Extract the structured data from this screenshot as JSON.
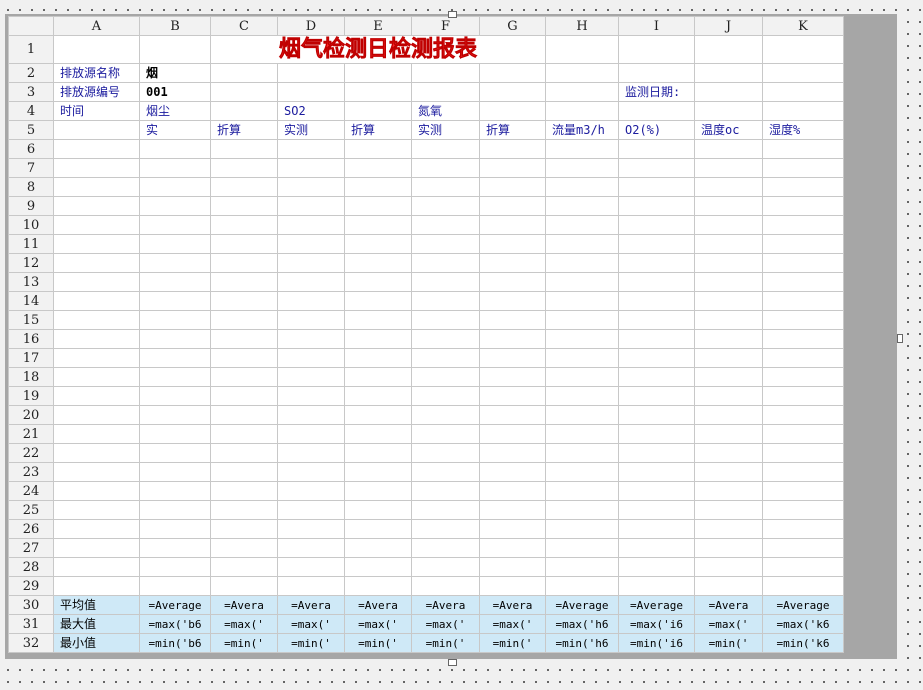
{
  "columns": [
    "A",
    "B",
    "C",
    "D",
    "E",
    "F",
    "G",
    "H",
    "I",
    "J",
    "K"
  ],
  "title": "烟气检测日检测报表",
  "row2": {
    "a": "排放源名称",
    "b": "烟"
  },
  "row3": {
    "a": "排放源编号",
    "b": "001",
    "i": "监测日期:"
  },
  "row4": {
    "a": "时间",
    "b": "烟尘",
    "d": "SO2",
    "f": "氮氧"
  },
  "row5": [
    "",
    "实",
    "折算",
    "实测",
    "折算",
    "实测",
    "折算",
    "流量m3/h",
    "O2(%)",
    "温度oc",
    "湿度%"
  ],
  "empty_rows": [
    6,
    7,
    8,
    9,
    10,
    11,
    12,
    13,
    14,
    15,
    16,
    17,
    18,
    19,
    20,
    21,
    22,
    23,
    24,
    25,
    26,
    27,
    28,
    29
  ],
  "stats": [
    {
      "row": "30",
      "label": "平均值",
      "cells": [
        "=Average",
        "=Avera",
        "=Avera",
        "=Avera",
        "=Avera",
        "=Avera",
        "=Average",
        "=Average",
        "=Avera",
        "=Average"
      ]
    },
    {
      "row": "31",
      "label": "最大值",
      "cells": [
        "=max('b6",
        "=max('",
        "=max('",
        "=max('",
        "=max('",
        "=max('",
        "=max('h6",
        "=max('i6",
        "=max('",
        "=max('k6"
      ]
    },
    {
      "row": "32",
      "label": "最小值",
      "cells": [
        "=min('b6",
        "=min('",
        "=min('",
        "=min('",
        "=min('",
        "=min('",
        "=min('h6",
        "=min('i6",
        "=min('",
        "=min('k6"
      ]
    }
  ],
  "colors": {
    "stat_row_bg": "#cfe9f7",
    "label_text": "#1b1b9e",
    "title_red": "#ff2a2a",
    "panel_gray": "#a6a6a6"
  }
}
